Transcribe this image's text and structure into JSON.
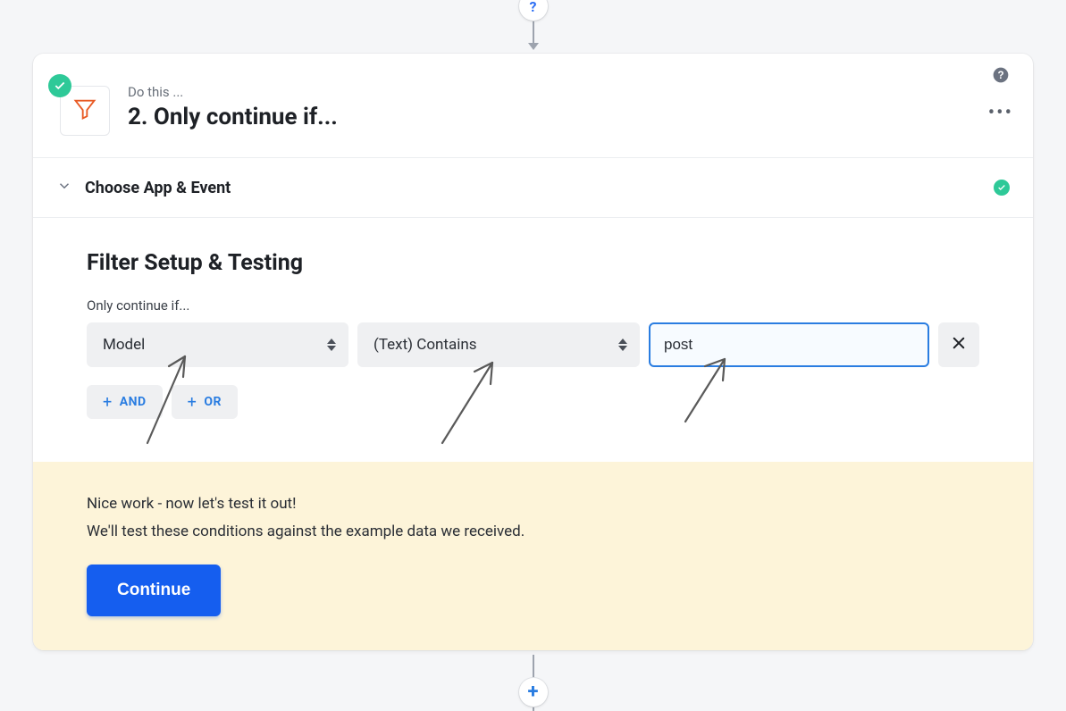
{
  "header": {
    "eyebrow": "Do this ...",
    "title": "2. Only continue if..."
  },
  "accordion": {
    "title": "Choose App & Event"
  },
  "filter": {
    "section_title": "Filter Setup & Testing",
    "label": "Only continue if...",
    "field_value": "Model",
    "operator_value": "(Text) Contains",
    "input_value": "post",
    "and_label": "AND",
    "or_label": "OR"
  },
  "test": {
    "line1": "Nice work - now let's test it out!",
    "line2": "We'll test these conditions against the example data we received.",
    "continue": "Continue"
  }
}
